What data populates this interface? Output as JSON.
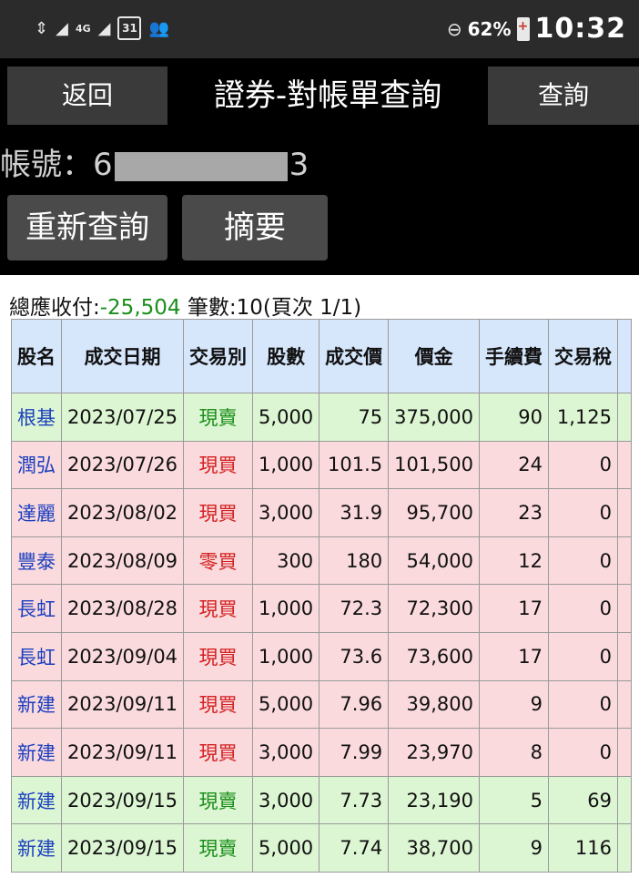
{
  "statusbar": {
    "network": "4G",
    "calendar_day": "31",
    "battery_percent": "62%",
    "time": "10:32"
  },
  "header": {
    "back_label": "返回",
    "title": "證券-對帳單查詢",
    "query_label": "查詢"
  },
  "account": {
    "label": "帳號：",
    "prefix": "6",
    "suffix": "3"
  },
  "actions": {
    "requery_label": "重新查詢",
    "summary_label": "摘要"
  },
  "summary": {
    "total_label": "總應收付:",
    "total_value": "-25,504",
    "count_text": " 筆數:10(頁次 1/1)"
  },
  "table": {
    "headers": [
      "股名",
      "成交日期",
      "交易別",
      "股數",
      "成交價",
      "價金",
      "手續費",
      "交易稅"
    ],
    "rows": [
      {
        "name": "根基",
        "date": "2023/07/25",
        "type": "現賣",
        "kind": "sell",
        "shares": "5,000",
        "price": "75",
        "amount": "375,000",
        "fee": "90",
        "tax": "1,125"
      },
      {
        "name": "潤弘",
        "date": "2023/07/26",
        "type": "現買",
        "kind": "buy",
        "shares": "1,000",
        "price": "101.5",
        "amount": "101,500",
        "fee": "24",
        "tax": "0"
      },
      {
        "name": "達麗",
        "date": "2023/08/02",
        "type": "現買",
        "kind": "buy",
        "shares": "3,000",
        "price": "31.9",
        "amount": "95,700",
        "fee": "23",
        "tax": "0"
      },
      {
        "name": "豐泰",
        "date": "2023/08/09",
        "type": "零買",
        "kind": "buy",
        "shares": "300",
        "price": "180",
        "amount": "54,000",
        "fee": "12",
        "tax": "0"
      },
      {
        "name": "長虹",
        "date": "2023/08/28",
        "type": "現買",
        "kind": "buy",
        "shares": "1,000",
        "price": "72.3",
        "amount": "72,300",
        "fee": "17",
        "tax": "0"
      },
      {
        "name": "長虹",
        "date": "2023/09/04",
        "type": "現買",
        "kind": "buy",
        "shares": "1,000",
        "price": "73.6",
        "amount": "73,600",
        "fee": "17",
        "tax": "0"
      },
      {
        "name": "新建",
        "date": "2023/09/11",
        "type": "現買",
        "kind": "buy",
        "shares": "5,000",
        "price": "7.96",
        "amount": "39,800",
        "fee": "9",
        "tax": "0"
      },
      {
        "name": "新建",
        "date": "2023/09/11",
        "type": "現買",
        "kind": "buy",
        "shares": "3,000",
        "price": "7.99",
        "amount": "23,970",
        "fee": "8",
        "tax": "0"
      },
      {
        "name": "新建",
        "date": "2023/09/15",
        "type": "現賣",
        "kind": "sell",
        "shares": "3,000",
        "price": "7.73",
        "amount": "23,190",
        "fee": "5",
        "tax": "69"
      },
      {
        "name": "新建",
        "date": "2023/09/15",
        "type": "現賣",
        "kind": "sell",
        "shares": "5,000",
        "price": "7.74",
        "amount": "38,700",
        "fee": "9",
        "tax": "116"
      }
    ]
  }
}
